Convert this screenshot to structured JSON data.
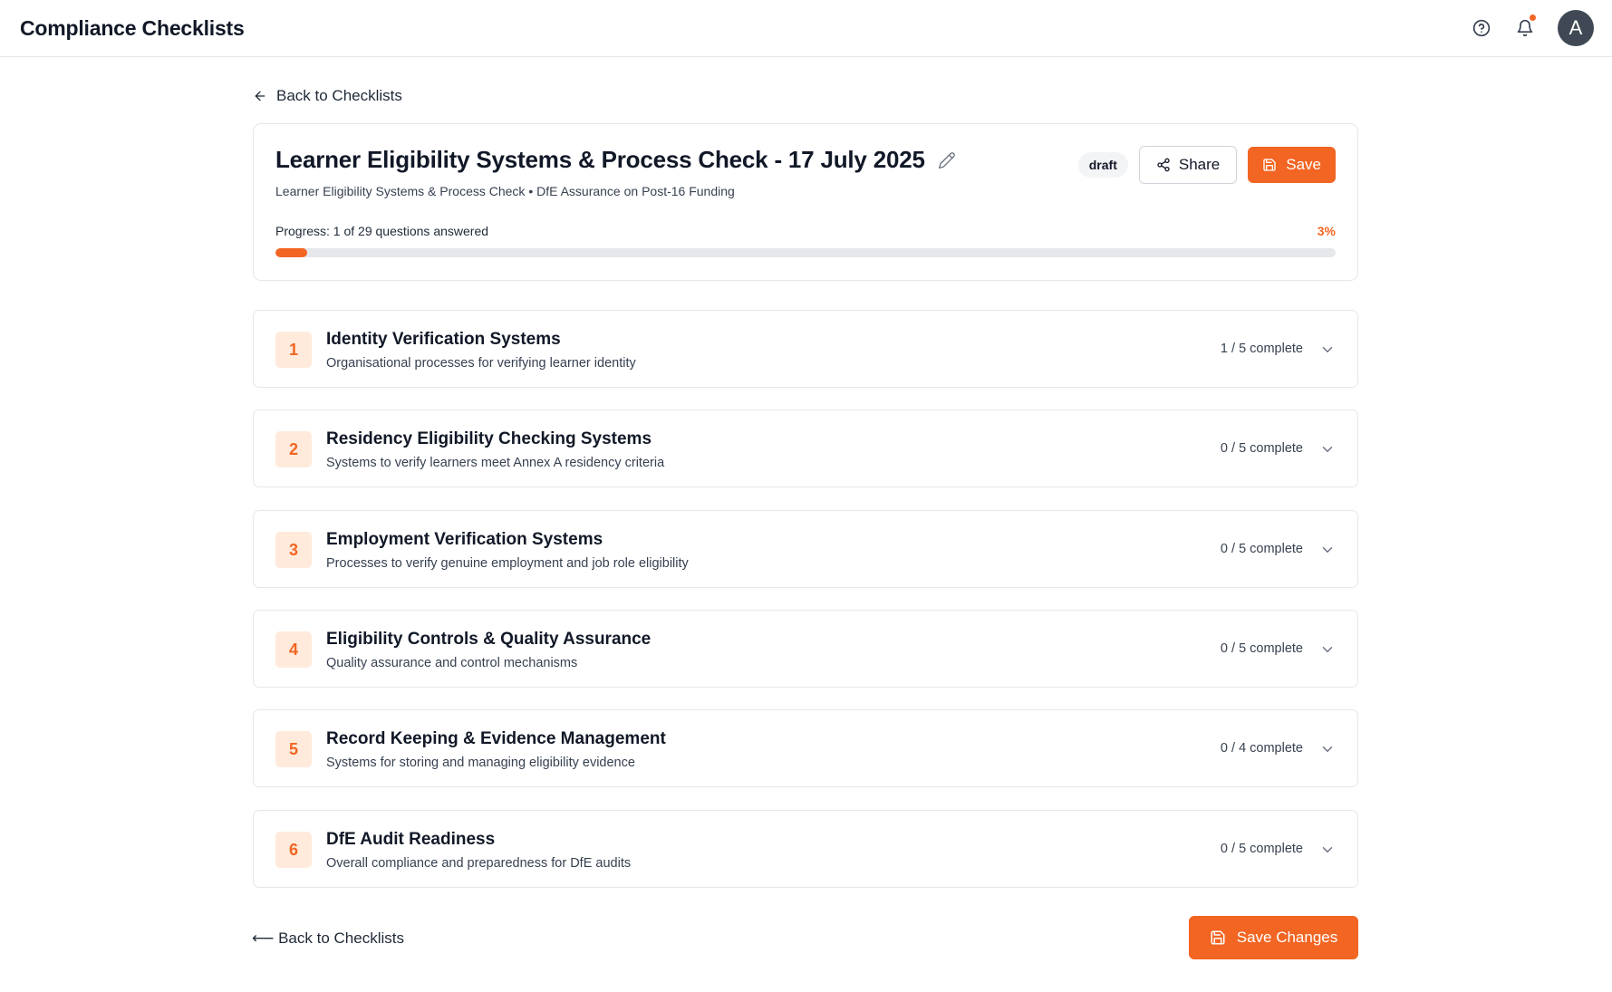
{
  "app": {
    "title": "Compliance Checklists",
    "accent_color": "#f26522"
  },
  "topbar": {
    "icons": [
      "help-circle-icon",
      "bell-icon"
    ],
    "notification_dot": true,
    "avatar_initial": "A"
  },
  "back_link": {
    "label": "Back to Checklists"
  },
  "header": {
    "title": "Learner Eligibility Systems & Process Check - 17 July 2025",
    "subtitle": "Learner Eligibility Systems & Process Check • DfE Assurance on Post-16 Funding",
    "status_badge": "draft",
    "share_label": "Share",
    "save_label": "Save",
    "progress_label": "Progress: 1 of 29 questions answered",
    "progress_percent": "3%",
    "progress_value": 0.03
  },
  "sections": [
    {
      "number": "1",
      "title": "Identity Verification Systems",
      "description": "Organisational processes for verifying learner identity",
      "count": "1 / 5 complete"
    },
    {
      "number": "2",
      "title": "Residency Eligibility Checking Systems",
      "description": "Systems to verify learners meet Annex A residency criteria",
      "count": "0 / 5 complete"
    },
    {
      "number": "3",
      "title": "Employment Verification Systems",
      "description": "Processes to verify genuine employment and job role eligibility",
      "count": "0 / 5 complete"
    },
    {
      "number": "4",
      "title": "Eligibility Controls & Quality Assurance",
      "description": "Quality assurance and control mechanisms",
      "count": "0 / 5 complete"
    },
    {
      "number": "5",
      "title": "Record Keeping & Evidence Management",
      "description": "Systems for storing and managing eligibility evidence",
      "count": "0 / 4 complete"
    },
    {
      "number": "6",
      "title": "DfE Audit Readiness",
      "description": "Overall compliance and preparedness for DfE audits",
      "count": "0 / 5 complete"
    }
  ],
  "footer": {
    "back_label": "⟵ Back to Checklists",
    "save_changes_label": "Save Changes"
  }
}
